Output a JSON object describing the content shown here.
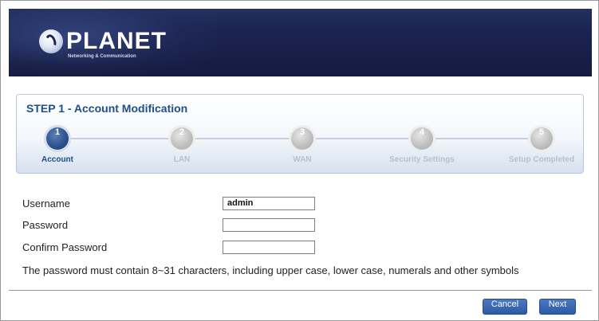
{
  "header": {
    "brand": "PLANET",
    "tagline": "Networking & Communication",
    "background_color": "#1b2350"
  },
  "wizard": {
    "title": "STEP 1 - Account Modification",
    "steps": [
      {
        "number": "1",
        "label": "Account",
        "active": true
      },
      {
        "number": "2",
        "label": "LAN",
        "active": false
      },
      {
        "number": "3",
        "label": "WAN",
        "active": false
      },
      {
        "number": "4",
        "label": "Security Settings",
        "active": false
      },
      {
        "number": "5",
        "label": "Setup Completed",
        "active": false
      }
    ],
    "active_color": "#1f4e8c",
    "inactive_color": "#b9c0c9"
  },
  "form": {
    "username_label": "Username",
    "username_value": "admin",
    "password_label": "Password",
    "password_value": "",
    "confirm_label": "Confirm Password",
    "confirm_value": "",
    "note": "The password must contain 8~31 characters, including upper case, lower case, numerals and other symbols"
  },
  "buttons": {
    "cancel": "Cancel",
    "next": "Next",
    "color": "#2d5aa5"
  }
}
